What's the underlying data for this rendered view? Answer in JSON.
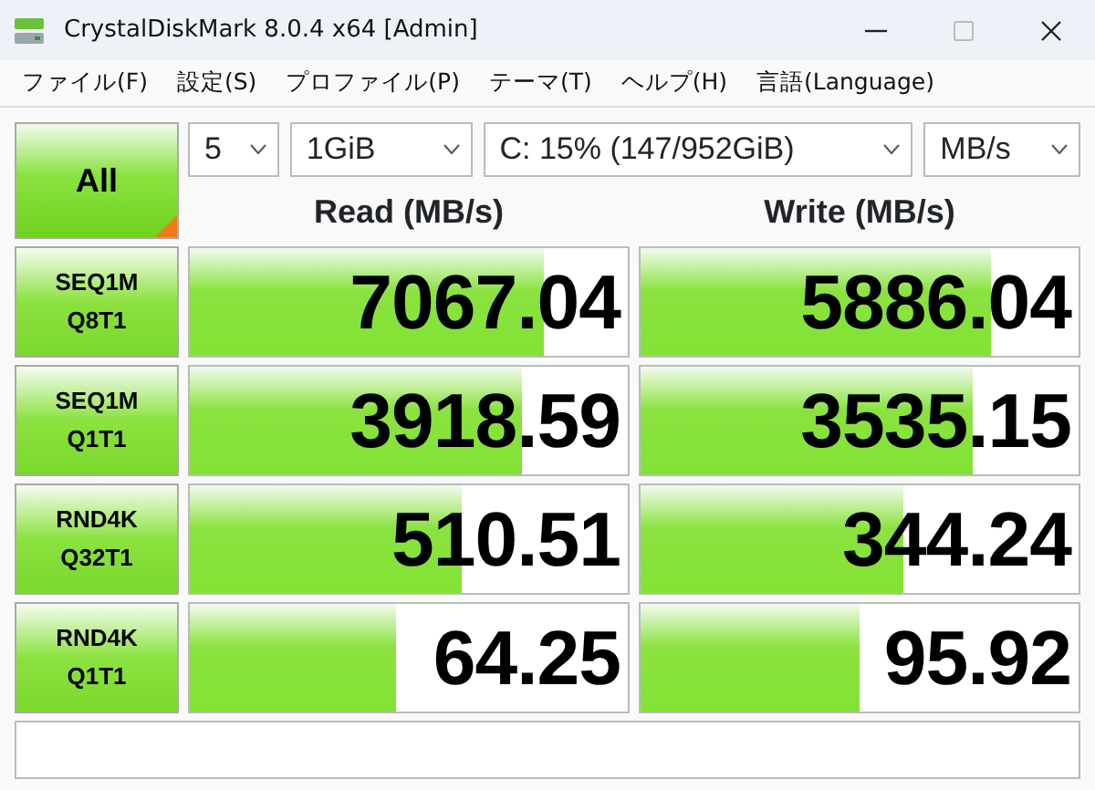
{
  "window": {
    "title": "CrystalDiskMark 8.0.4 x64 [Admin]"
  },
  "menu": [
    "ファイル(F)",
    "設定(S)",
    "プロファイル(P)",
    "テーマ(T)",
    "ヘルプ(H)",
    "言語(Language)"
  ],
  "controls": {
    "all_button": "All",
    "count": "5",
    "size": "1GiB",
    "drive": "C: 15% (147/952GiB)",
    "unit": "MB/s"
  },
  "headers": [
    "Read (MB/s)",
    "Write (MB/s)"
  ],
  "tests": [
    {
      "name": "SEQ1M",
      "params": "Q8T1",
      "read": {
        "value": "7067.04",
        "level": 0.81
      },
      "write": {
        "value": "5886.04",
        "level": 0.8
      }
    },
    {
      "name": "SEQ1M",
      "params": "Q1T1",
      "read": {
        "value": "3918.59",
        "level": 0.76
      },
      "write": {
        "value": "3535.15",
        "level": 0.76
      }
    },
    {
      "name": "RND4K",
      "params": "Q32T1",
      "read": {
        "value": "510.51",
        "level": 0.62
      },
      "write": {
        "value": "344.24",
        "level": 0.6
      }
    },
    {
      "name": "RND4K",
      "params": "Q1T1",
      "read": {
        "value": "64.25",
        "level": 0.47
      },
      "write": {
        "value": "95.92",
        "level": 0.5
      }
    }
  ]
}
